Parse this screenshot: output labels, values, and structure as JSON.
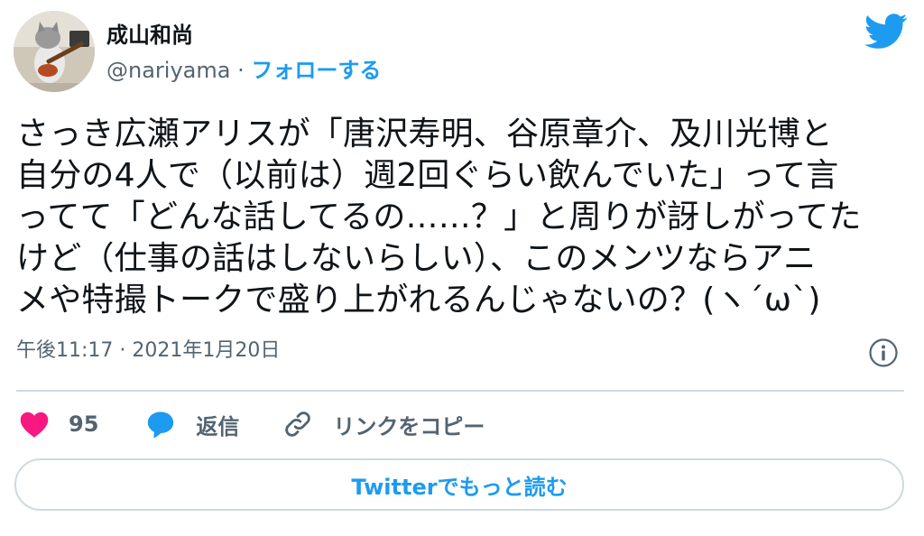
{
  "author": {
    "name": "成山和尚",
    "handle": "@nariyama",
    "separator": "·",
    "follow_label": "フォローする"
  },
  "tweet": {
    "text": "さっき広瀬アリスが「唐沢寿明、谷原章介、及川光博と\n自分の4人で（以前は）週2回ぐらい飲んでいた」って言\nってて「どんな話してるの……？」と周りが訝しがってた\nけど（仕事の話はしないらしい）、このメンツならアニ\nメや特撮トークで盛り上がれるんじゃないの？(ヽ´ω`)",
    "timestamp": "午後11:17 · 2021年1月20日"
  },
  "actions": {
    "like_count": "95",
    "reply_label": "返信",
    "copy_link_label": "リンクをコピー"
  },
  "read_more_label": "Twitterでもっと読む",
  "colors": {
    "accent": "#1d9bf0",
    "like": "#f91880",
    "muted": "#536471",
    "divider": "#cfd9de"
  },
  "icons": [
    "avatar-cat",
    "twitter-bird-icon",
    "info-icon",
    "heart-icon",
    "reply-bubble-icon",
    "link-icon"
  ]
}
